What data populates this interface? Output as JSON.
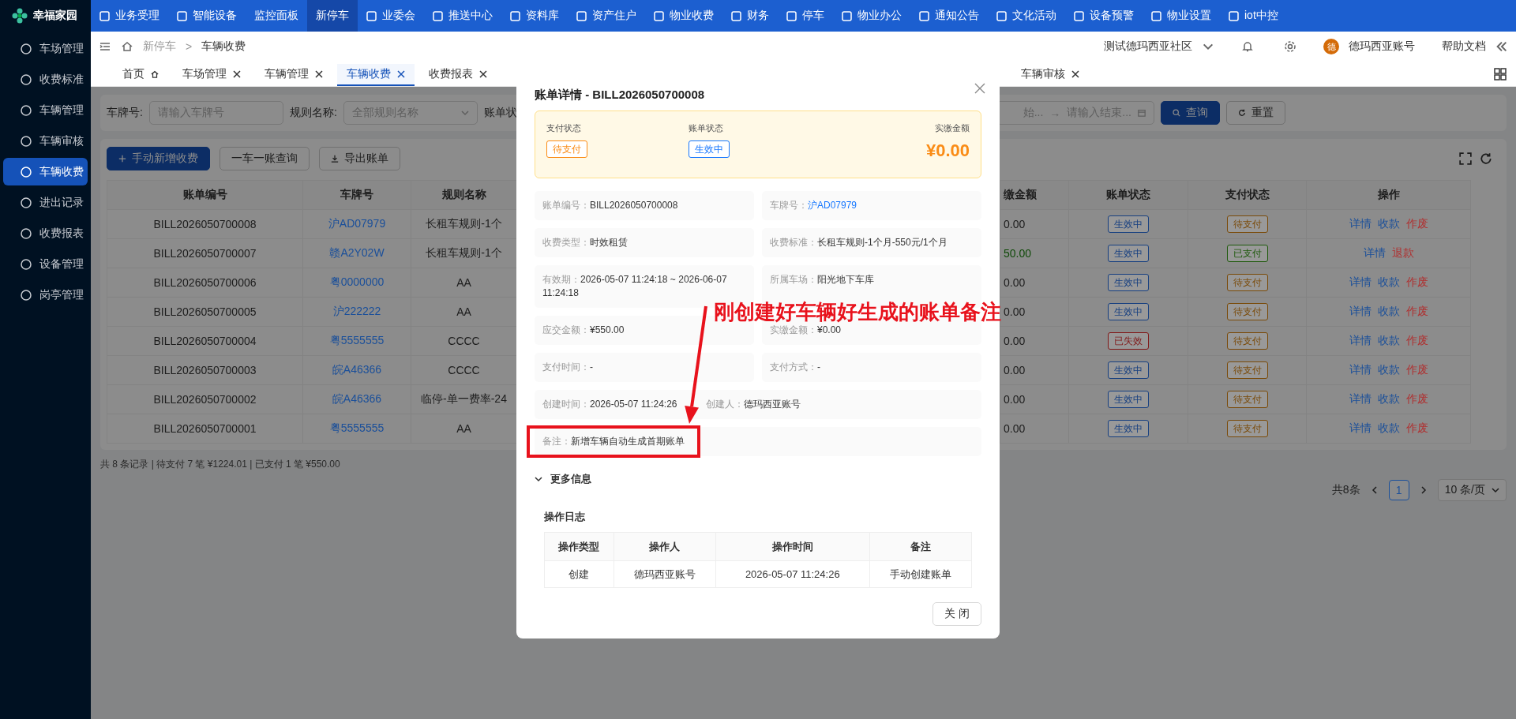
{
  "top_nav": {
    "logo": "幸福家园",
    "items": [
      {
        "label": "业务受理",
        "kind": "iconic",
        "selected": false
      },
      {
        "label": "智能设备",
        "kind": "iconic",
        "selected": false
      },
      {
        "label": "监控面板",
        "kind": "plain",
        "selected": false
      },
      {
        "label": "新停车",
        "kind": "plain",
        "selected": true
      },
      {
        "label": "业委会",
        "kind": "iconic",
        "selected": false
      },
      {
        "label": "推送中心",
        "kind": "iconic",
        "selected": false
      },
      {
        "label": "资料库",
        "kind": "iconic",
        "selected": false
      },
      {
        "label": "资产住户",
        "kind": "iconic",
        "selected": false
      },
      {
        "label": "物业收费",
        "kind": "iconic",
        "selected": false
      },
      {
        "label": "财务",
        "kind": "iconic",
        "selected": false
      },
      {
        "label": "停车",
        "kind": "iconic",
        "selected": false
      },
      {
        "label": "物业办公",
        "kind": "iconic",
        "selected": false
      },
      {
        "label": "通知公告",
        "kind": "iconic",
        "selected": false
      },
      {
        "label": "文化活动",
        "kind": "iconic",
        "selected": false
      },
      {
        "label": "设备预警",
        "kind": "iconic",
        "selected": false
      },
      {
        "label": "物业设置",
        "kind": "iconic",
        "selected": false
      },
      {
        "label": "iot中控",
        "kind": "iconic",
        "selected": false
      }
    ]
  },
  "sidebar": {
    "items": [
      {
        "label": "车场管理",
        "selected": false
      },
      {
        "label": "收费标准",
        "selected": false
      },
      {
        "label": "车辆管理",
        "selected": false
      },
      {
        "label": "车辆审核",
        "selected": false
      },
      {
        "label": "车辆收费",
        "selected": true
      },
      {
        "label": "进出记录",
        "selected": false
      },
      {
        "label": "收费报表",
        "selected": false
      },
      {
        "label": "设备管理",
        "selected": false
      },
      {
        "label": "岗亭管理",
        "selected": false
      }
    ]
  },
  "breadcrumb": {
    "items": [
      "新停车",
      "车辆收费"
    ],
    "separator": ">"
  },
  "header_right": {
    "community": "测试德玛西亚社区",
    "avatar_text": "德",
    "user": "德玛西亚账号",
    "help": "帮助文档"
  },
  "tabs": [
    {
      "label": "首页",
      "kind": "home",
      "selected": false
    },
    {
      "label": "车场管理",
      "kind": "closable",
      "selected": false
    },
    {
      "label": "车辆管理",
      "kind": "closable",
      "selected": false
    },
    {
      "label": "车辆收费",
      "kind": "closable",
      "selected": true
    },
    {
      "label": "收费报表",
      "kind": "closable",
      "selected": false
    },
    {
      "label": "车辆审核",
      "kind": "closable",
      "selected": false
    }
  ],
  "filters": {
    "plate_label": "车牌号:",
    "plate_placeholder": "请输入车牌号",
    "rule_label": "规则名称:",
    "rule_placeholder": "全部规则名称",
    "status_label": "账单状",
    "date_start": "始...",
    "date_separator": "→",
    "date_end": "请输入结束...",
    "search_button": "查询",
    "reset_button": "重置"
  },
  "toolbar": {
    "buttons": [
      {
        "label": "手动新增收费",
        "kind": "primary"
      },
      {
        "label": "一车一账查询",
        "kind": "plain"
      },
      {
        "label": "导出账单",
        "kind": "export"
      }
    ]
  },
  "table": {
    "columns": [
      {
        "label": "账单编号",
        "kind": "text"
      },
      {
        "label": "车牌号",
        "kind": "link"
      },
      {
        "label": "规则名称",
        "kind": "text"
      },
      {
        "label": "缴金额",
        "kind": "amount"
      },
      {
        "label": "账单状态",
        "kind": "tag"
      },
      {
        "label": "支付状态",
        "kind": "tag"
      },
      {
        "label": "操作",
        "kind": "actions"
      }
    ],
    "rows": [
      [
        "BILL2026050700008",
        "沪AD07979",
        "长租车规则-1个",
        {
          "text": "0.00",
          "color": "#1c1c1c"
        },
        {
          "text": "生效中",
          "color": "#163f80"
        },
        {
          "text": "待支付",
          "color": "#7a4a08"
        },
        [
          {
            "label": "详情",
            "danger": false
          },
          {
            "label": "收款",
            "danger": false
          },
          {
            "label": "作废",
            "danger": true
          }
        ]
      ],
      [
        "BILL2026050700007",
        "赣A2Y02W",
        "长租车规则-1个",
        {
          "text": "50.00",
          "color": "#0f4a08"
        },
        {
          "text": "生效中",
          "color": "#163f80"
        },
        {
          "text": "已支付",
          "color": "#1f5a0c"
        },
        [
          {
            "label": "详情",
            "danger": false
          },
          {
            "label": "退款",
            "danger": true
          }
        ]
      ],
      [
        "BILL2026050700006",
        "粤0000000",
        "AA",
        {
          "text": "0.00",
          "color": "#1c1c1c"
        },
        {
          "text": "生效中",
          "color": "#163f80"
        },
        {
          "text": "待支付",
          "color": "#7a4a08"
        },
        [
          {
            "label": "详情",
            "danger": false
          },
          {
            "label": "收款",
            "danger": false
          },
          {
            "label": "作废",
            "danger": true
          }
        ]
      ],
      [
        "BILL2026050700005",
        "沪222222",
        "AA",
        {
          "text": "0.00",
          "color": "#1c1c1c"
        },
        {
          "text": "生效中",
          "color": "#163f80"
        },
        {
          "text": "待支付",
          "color": "#7a4a08"
        },
        [
          {
            "label": "详情",
            "danger": false
          },
          {
            "label": "收款",
            "danger": false
          },
          {
            "label": "作废",
            "danger": true
          }
        ]
      ],
      [
        "BILL2026050700004",
        "粤5555555",
        "CCCC",
        {
          "text": "0.00",
          "color": "#1c1c1c"
        },
        {
          "text": "已失效",
          "color": "#801818"
        },
        {
          "text": "待支付",
          "color": "#7a4a08"
        },
        [
          {
            "label": "详情",
            "danger": false
          },
          {
            "label": "收款",
            "danger": false
          },
          {
            "label": "作废",
            "danger": true
          }
        ]
      ],
      [
        "BILL2026050700003",
        "皖A46366",
        "CCCC",
        {
          "text": "0.00",
          "color": "#1c1c1c"
        },
        {
          "text": "生效中",
          "color": "#163f80"
        },
        {
          "text": "待支付",
          "color": "#7a4a08"
        },
        [
          {
            "label": "详情",
            "danger": false
          },
          {
            "label": "收款",
            "danger": false
          },
          {
            "label": "作废",
            "danger": true
          }
        ]
      ],
      [
        "BILL2026050700002",
        "皖A46366",
        "临停-单一费率-24",
        {
          "text": "0.00",
          "color": "#1c1c1c"
        },
        {
          "text": "生效中",
          "color": "#163f80"
        },
        {
          "text": "待支付",
          "color": "#7a4a08"
        },
        [
          {
            "label": "详情",
            "danger": false
          },
          {
            "label": "收款",
            "danger": false
          },
          {
            "label": "作废",
            "danger": true
          }
        ]
      ],
      [
        "BILL2026050700001",
        "粤5555555",
        "AA",
        {
          "text": "0.00",
          "color": "#1c1c1c"
        },
        {
          "text": "生效中",
          "color": "#163f80"
        },
        {
          "text": "待支付",
          "color": "#7a4a08"
        },
        [
          {
            "label": "详情",
            "danger": false
          },
          {
            "label": "收款",
            "danger": false
          },
          {
            "label": "作废",
            "danger": true
          }
        ]
      ]
    ]
  },
  "summary": "共 8 条记录 | 待支付 7 笔 ¥1224.01 | 已支付 1 笔 ¥550.00",
  "pagination": {
    "total": "共8条",
    "pages": [
      {
        "label": "1",
        "selected": true
      }
    ],
    "page_size": "10 条/页"
  },
  "modal": {
    "title": "账单详情 - BILL2026050700008",
    "status_box": {
      "pay_label": "支付状态",
      "pay_tag": {
        "text": "待支付",
        "color": "#fa8c16"
      },
      "bill_label": "账单状态",
      "bill_tag": {
        "text": "生效中",
        "color": "#1677ff"
      },
      "amount_label": "实缴金额",
      "amount": "¥0.00"
    },
    "fields": [
      {
        "kind": "half",
        "highlighted": false,
        "parts": [
          {
            "label": "账单编号：",
            "value": "BILL2026050700008",
            "link": false
          }
        ]
      },
      {
        "kind": "half",
        "highlighted": false,
        "parts": [
          {
            "label": "车牌号：",
            "value": "沪AD07979",
            "link": true
          }
        ]
      },
      {
        "kind": "half",
        "highlighted": false,
        "parts": [
          {
            "label": "收费类型：",
            "value": "时效租赁",
            "link": false
          }
        ]
      },
      {
        "kind": "half",
        "highlighted": false,
        "parts": [
          {
            "label": "收费标准：",
            "value": "长租车规则-1个月-550元/1个月",
            "link": false
          }
        ]
      },
      {
        "kind": "half",
        "highlighted": false,
        "parts": [
          {
            "label": "有效期：",
            "value": "2026-05-07 11:24:18 ~ 2026-06-07 11:24:18",
            "link": false
          }
        ]
      },
      {
        "kind": "half",
        "highlighted": false,
        "parts": [
          {
            "label": "所属车场：",
            "value": "阳光地下车库",
            "link": false
          }
        ]
      },
      {
        "kind": "half",
        "highlighted": false,
        "parts": [
          {
            "label": "应交金额：",
            "value": "¥550.00",
            "link": false
          }
        ]
      },
      {
        "kind": "half",
        "highlighted": false,
        "parts": [
          {
            "label": "实缴金额：",
            "value": "¥0.00",
            "link": false
          }
        ]
      },
      {
        "kind": "half",
        "highlighted": false,
        "parts": [
          {
            "label": "支付时间：",
            "value": "-",
            "link": false
          }
        ]
      },
      {
        "kind": "half",
        "highlighted": false,
        "parts": [
          {
            "label": "支付方式：",
            "value": "-",
            "link": false
          }
        ]
      },
      {
        "kind": "full",
        "highlighted": false,
        "parts": [
          {
            "label": "创建时间：",
            "value": "2026-05-07 11:24:26",
            "link": false
          },
          {
            "label": "创建人：",
            "value": "德玛西亚账号",
            "link": false
          }
        ]
      },
      {
        "kind": "full",
        "highlighted": true,
        "parts": [
          {
            "label": "备注：",
            "value": "新增车辆自动生成首期账单",
            "link": false
          }
        ]
      }
    ],
    "more": {
      "label": "更多信息",
      "expanded": true
    },
    "log": {
      "title": "操作日志",
      "columns": [
        "操作类型",
        "操作人",
        "操作时间",
        "备注"
      ],
      "rows": [
        [
          "创建",
          "德玛西亚账号",
          "2026-05-07 11:24:26",
          "手动创建账单"
        ]
      ]
    },
    "close_button": "关 闭"
  },
  "annotation": {
    "text": "刚创建好车辆好生成的账单备注"
  }
}
